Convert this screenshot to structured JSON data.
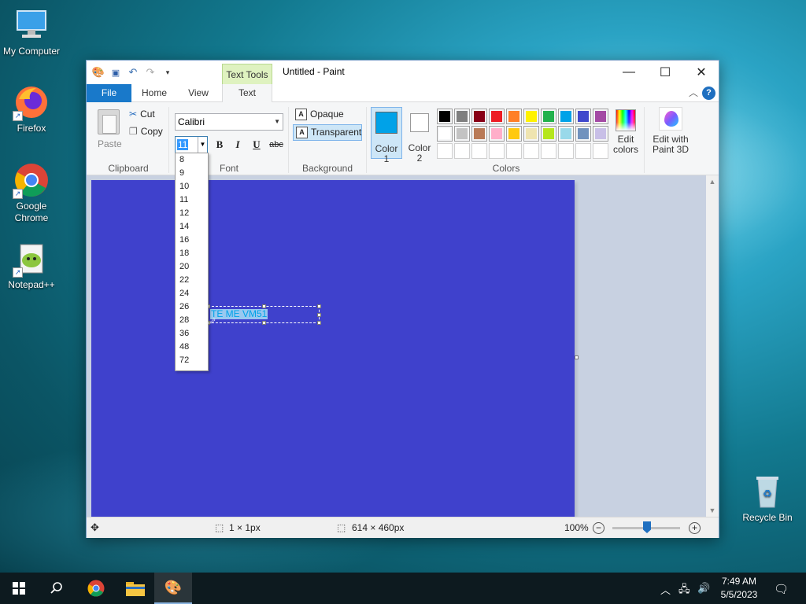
{
  "desktop": {
    "icons": [
      {
        "label": "My Computer"
      },
      {
        "label": "Firefox"
      },
      {
        "label": "Google Chrome"
      },
      {
        "label": "Notepad++"
      },
      {
        "label": "Recycle Bin"
      }
    ]
  },
  "window": {
    "title": "Untitled - Paint",
    "context_tab": "Text Tools",
    "tabs": [
      "File",
      "Home",
      "View",
      "Text"
    ],
    "active_tab": "Text"
  },
  "clipboard": {
    "paste": "Paste",
    "cut": "Cut",
    "copy": "Copy",
    "group": "Clipboard"
  },
  "font": {
    "family": "Calibri",
    "size": "11",
    "group": "Font",
    "bold": "B",
    "italic": "I",
    "underline": "U",
    "strike": "abc",
    "size_options": [
      "8",
      "9",
      "10",
      "11",
      "12",
      "14",
      "16",
      "18",
      "20",
      "22",
      "24",
      "26",
      "28",
      "36",
      "48",
      "72"
    ]
  },
  "background": {
    "opaque": "Opaque",
    "transparent": "Transparent",
    "selected": "Transparent",
    "group": "Background"
  },
  "colors": {
    "color1_label": "Color 1",
    "color2_label": "Color 2",
    "color1": "#00a2e8",
    "color2": "#ffffff",
    "palette_row1": [
      "#000000",
      "#7f7f7f",
      "#880015",
      "#ed1c24",
      "#ff7f27",
      "#fff200",
      "#22b14c",
      "#00a2e8",
      "#3f48cc",
      "#a349a4"
    ],
    "palette_row2": [
      "#ffffff",
      "#c3c3c3",
      "#b97a57",
      "#ffaec9",
      "#ffc90e",
      "#efe4b0",
      "#b5e61d",
      "#99d9ea",
      "#7092be",
      "#c8bfe7"
    ],
    "edit_colors": "Edit colors",
    "edit_paint3d": "Edit with Paint 3D",
    "group": "Colors"
  },
  "canvas": {
    "background": "#3f41cc",
    "text_content": "TE ME VM51"
  },
  "status": {
    "selection": "1 × 1px",
    "size": "614 × 460px",
    "zoom": "100%"
  },
  "taskbar": {
    "time": "7:49 AM",
    "date": "5/5/2023"
  }
}
